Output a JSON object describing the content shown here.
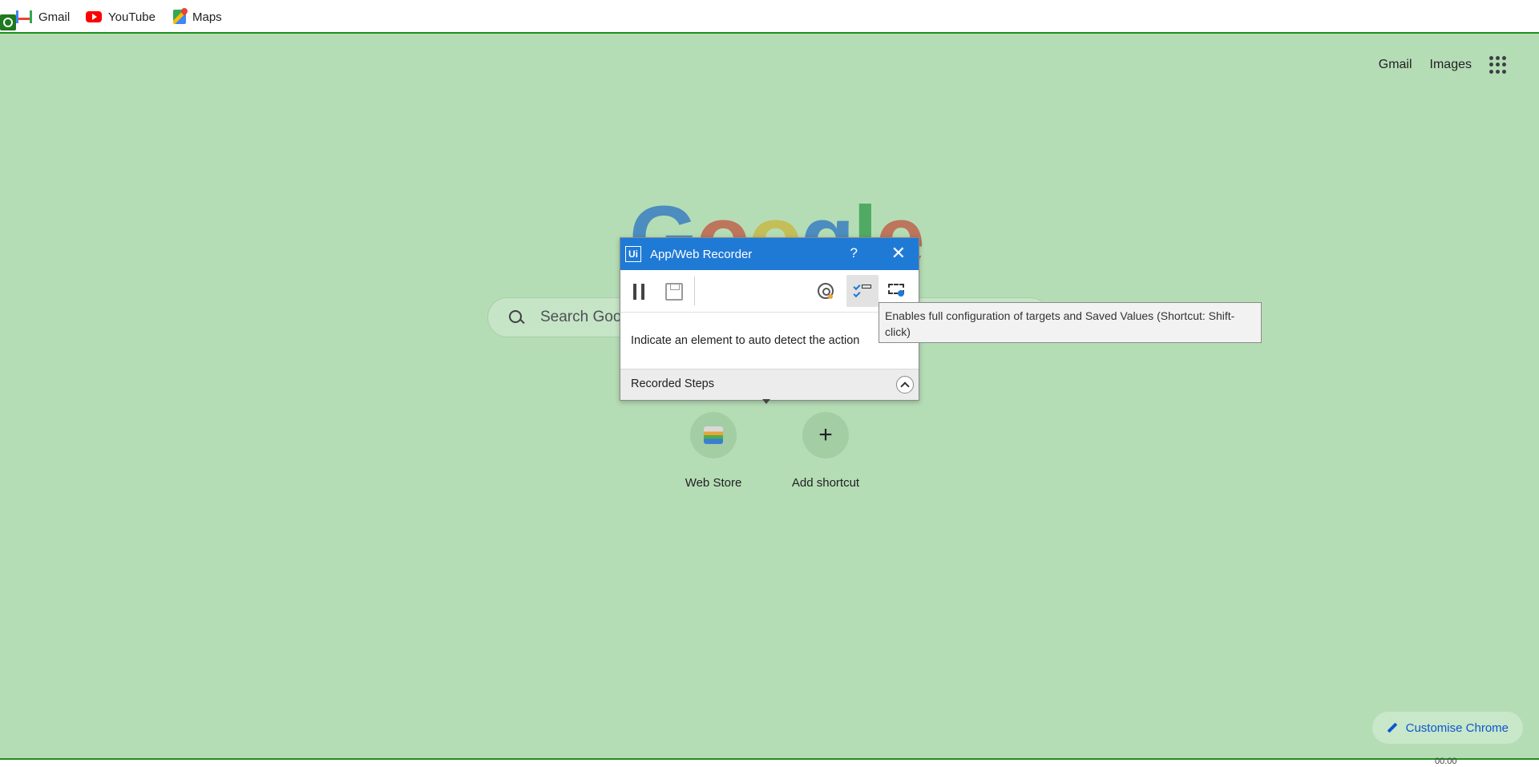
{
  "bookmarks": [
    {
      "label": "Gmail",
      "icon": "gmail-icon"
    },
    {
      "label": "YouTube",
      "icon": "youtube-icon"
    },
    {
      "label": "Maps",
      "icon": "maps-icon"
    }
  ],
  "header": {
    "gmail_link": "Gmail",
    "images_link": "Images",
    "apps_icon": "google-apps-icon"
  },
  "search": {
    "placeholder": "Search Goo"
  },
  "shortcuts": [
    {
      "label": "Web Store",
      "icon": "webstore-icon"
    },
    {
      "label": "Add shortcut",
      "icon": "plus-icon"
    }
  ],
  "customise": {
    "label": "Customise Chrome",
    "icon": "pencil-icon"
  },
  "recorder": {
    "logo": "Ui",
    "title": "App/Web Recorder",
    "help_symbol": "?",
    "close_symbol": "✕",
    "instruction": "Indicate an element to auto detect the action",
    "steps_label": "Recorded Steps"
  },
  "tooltip": {
    "text": "Enables full configuration of targets and Saved Values (Shortcut: Shift-click)"
  },
  "colors": {
    "page_background": "#b5ddb5",
    "recorder_title_bar": "#1f7ad6",
    "highlight_border": "#1f8f1f"
  },
  "taskbar": {
    "time": "00:00"
  }
}
